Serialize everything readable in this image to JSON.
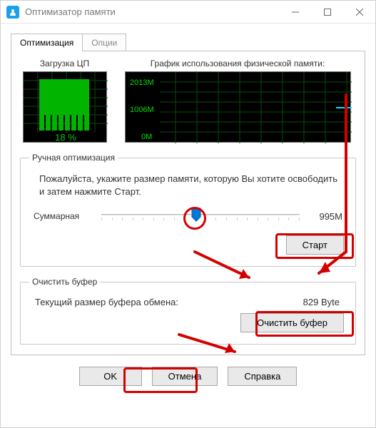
{
  "window": {
    "title": "Оптимизатор памяти"
  },
  "tabs": {
    "active": "Оптимизация",
    "inactive": "Опции"
  },
  "cpu": {
    "title": "Загрузка ЦП",
    "percent_label": "18 %"
  },
  "mem_graph": {
    "title": "График использования физической памяти:",
    "ylabels": [
      "2013M",
      "1006M",
      "0M"
    ]
  },
  "manual": {
    "legend": "Ручная оптимизация",
    "help": "Пожалуйста, укажите размер памяти, которую Вы хотите освободить и затем нажмите Старт.",
    "slider_label": "Суммарная",
    "slider_value": "995M",
    "start_btn": "Старт"
  },
  "buffer": {
    "legend": "Очистить буфер",
    "label": "Текущий размер буфера обмена:",
    "value": "829 Byte",
    "btn": "Очистить буфер"
  },
  "dialog": {
    "ok": "OK",
    "cancel": "Отмена",
    "help": "Справка"
  },
  "chart_data": {
    "cpu_load": {
      "type": "bar",
      "percent": 18
    },
    "phys_mem": {
      "type": "line",
      "ylabels_M": [
        2013,
        1006,
        0
      ],
      "current_value_M_approx": 1006
    }
  }
}
